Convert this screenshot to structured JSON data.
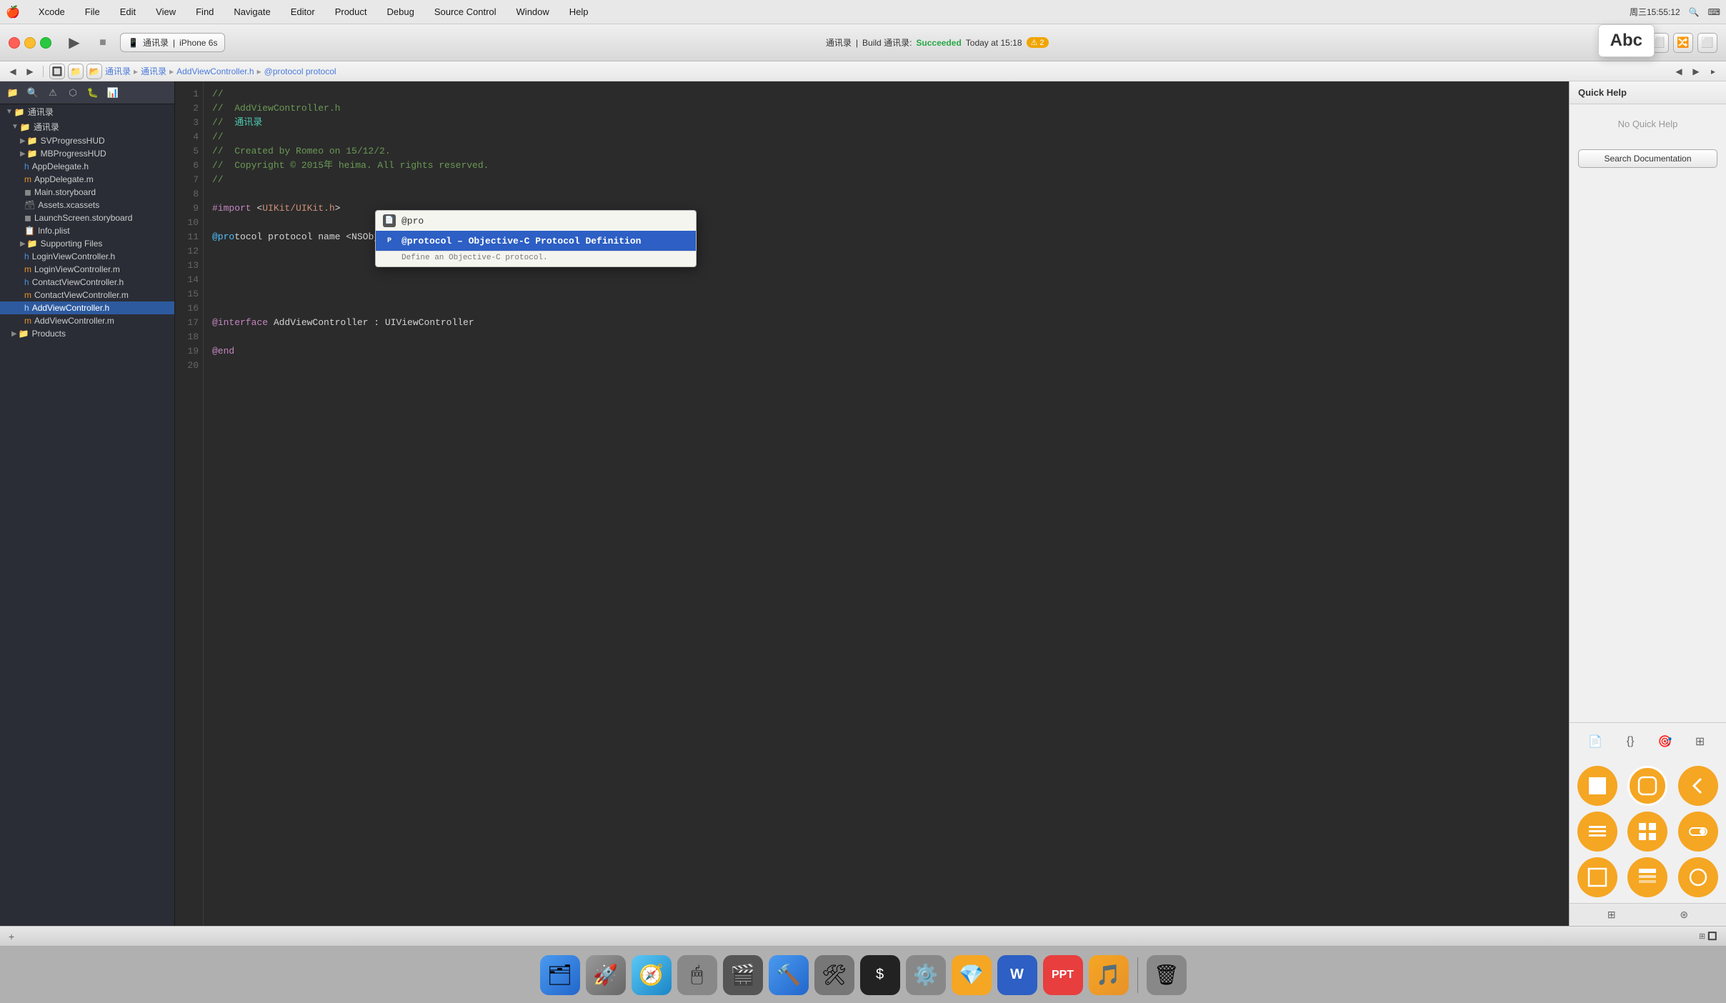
{
  "menubar": {
    "apple": "🍎",
    "items": [
      "Xcode",
      "File",
      "Edit",
      "View",
      "Find",
      "Navigate",
      "Editor",
      "Product",
      "Debug",
      "Source Control",
      "Window",
      "Help"
    ],
    "right": {
      "datetime": "周三15:55:12",
      "search_icon": "🔍",
      "input_icon": "⌨"
    }
  },
  "toolbar": {
    "traffic_lights": [
      "red",
      "yellow",
      "green"
    ],
    "run_label": "▶",
    "stop_label": "■",
    "scheme_name": "通讯录",
    "device": "iPhone 6s",
    "build_project": "通讯录",
    "build_separator": "|",
    "build_label": "Build 通讯录:",
    "build_status": "Succeeded",
    "build_time": "Today at 15:18",
    "warning_count": "⚠ 2"
  },
  "breadcrumb": {
    "items": [
      "通讯录",
      "通讯录",
      "AddViewController.h",
      "@protocol protocol"
    ]
  },
  "sidebar": {
    "title": "通讯录",
    "items": [
      {
        "id": "root-group",
        "label": "通讯录",
        "indent": 0,
        "type": "group",
        "expanded": true
      },
      {
        "id": "svprogress",
        "label": "SVProgressHUD",
        "indent": 1,
        "type": "folder",
        "expanded": false
      },
      {
        "id": "mbprogress",
        "label": "MBProgressHUD",
        "indent": 1,
        "type": "folder",
        "expanded": false
      },
      {
        "id": "appdelegate-h",
        "label": "AppDelegate.h",
        "indent": 1,
        "type": "file-h"
      },
      {
        "id": "appdelegate-m",
        "label": "AppDelegate.m",
        "indent": 1,
        "type": "file-m"
      },
      {
        "id": "main-storyboard",
        "label": "Main.storyboard",
        "indent": 1,
        "type": "file-storyboard"
      },
      {
        "id": "assets",
        "label": "Assets.xcassets",
        "indent": 1,
        "type": "file-assets"
      },
      {
        "id": "launchscreen",
        "label": "LaunchScreen.storyboard",
        "indent": 1,
        "type": "file-storyboard"
      },
      {
        "id": "info-plist",
        "label": "Info.plist",
        "indent": 1,
        "type": "file-plist"
      },
      {
        "id": "supporting",
        "label": "Supporting Files",
        "indent": 1,
        "type": "folder",
        "expanded": false
      },
      {
        "id": "loginvc-h",
        "label": "LoginViewController.h",
        "indent": 1,
        "type": "file-h"
      },
      {
        "id": "loginvc-m",
        "label": "LoginViewController.m",
        "indent": 1,
        "type": "file-m"
      },
      {
        "id": "contactvc-h",
        "label": "ContactViewController.h",
        "indent": 1,
        "type": "file-h"
      },
      {
        "id": "contactvc-m",
        "label": "ContactViewController.m",
        "indent": 1,
        "type": "file-m"
      },
      {
        "id": "addvc-h",
        "label": "AddViewController.h",
        "indent": 1,
        "type": "file-h",
        "selected": true
      },
      {
        "id": "addvc-m",
        "label": "AddViewController.m",
        "indent": 1,
        "type": "file-m"
      },
      {
        "id": "products",
        "label": "Products",
        "indent": 0,
        "type": "folder-products",
        "expanded": false
      }
    ]
  },
  "code": {
    "lines": [
      {
        "num": 1,
        "content": "//"
      },
      {
        "num": 2,
        "content": "//  AddViewController.h"
      },
      {
        "num": 3,
        "content": "//  通讯录"
      },
      {
        "num": 4,
        "content": "//"
      },
      {
        "num": 5,
        "content": "//  Created by Romeo on 15/12/2."
      },
      {
        "num": 6,
        "content": "//  Copyright © 2015年 heima. All rights reserved."
      },
      {
        "num": 7,
        "content": "//"
      },
      {
        "num": 8,
        "content": ""
      },
      {
        "num": 9,
        "content": "#import <UIKit/UIKit.h>"
      },
      {
        "num": 10,
        "content": ""
      },
      {
        "num": 11,
        "content": "@protocol protocol name <NSObject>"
      },
      {
        "num": 12,
        "content": ""
      },
      {
        "num": 13,
        "content": ""
      },
      {
        "num": 14,
        "content": ""
      },
      {
        "num": 15,
        "content": ""
      },
      {
        "num": 16,
        "content": ""
      },
      {
        "num": 17,
        "content": "@interface AddViewController : UIViewController"
      },
      {
        "num": 18,
        "content": ""
      },
      {
        "num": 19,
        "content": "@end"
      },
      {
        "num": 20,
        "content": ""
      }
    ]
  },
  "autocomplete": {
    "items": [
      {
        "id": "pro-snippet",
        "icon": "📄",
        "icon_type": "gray",
        "label": "@pro"
      },
      {
        "id": "protocol-def",
        "icon": "P",
        "icon_type": "blue",
        "label": "@protocol – Objective-C Protocol Definition",
        "selected": true
      }
    ],
    "description": "Define an Objective-C protocol."
  },
  "quick_help": {
    "title": "Quick Help",
    "empty_msg": "No Quick Help",
    "search_btn": "Search Documentation"
  },
  "right_panel_icons": {
    "icons": [
      "📄",
      "{}",
      "🎯",
      "⊞"
    ],
    "ui_elements": [
      {
        "id": "square",
        "shape": "square"
      },
      {
        "id": "rounded-rect",
        "shape": "rounded-rect"
      },
      {
        "id": "chevron-left",
        "shape": "chevron-left"
      },
      {
        "id": "list",
        "shape": "list"
      },
      {
        "id": "grid",
        "shape": "grid"
      },
      {
        "id": "toggle",
        "shape": "toggle"
      },
      {
        "id": "square2",
        "shape": "square2"
      },
      {
        "id": "table",
        "shape": "table"
      },
      {
        "id": "circle",
        "shape": "circle"
      }
    ]
  },
  "dock": {
    "items": [
      {
        "id": "finder",
        "label": "Finder",
        "color": "#4a9aef"
      },
      {
        "id": "launchpad",
        "label": "Launchpad",
        "color": "#888"
      },
      {
        "id": "safari",
        "label": "Safari",
        "color": "#4a9aef"
      },
      {
        "id": "mousepose",
        "label": "Mousepose",
        "color": "#888"
      },
      {
        "id": "footage",
        "label": "Footage",
        "color": "#888"
      },
      {
        "id": "xcode",
        "label": "Xcode",
        "color": "#4a9aef"
      },
      {
        "id": "hammer",
        "label": "Hammer",
        "color": "#888"
      },
      {
        "id": "terminal",
        "label": "Terminal",
        "color": "#333"
      },
      {
        "id": "settings",
        "label": "Settings",
        "color": "#888"
      },
      {
        "id": "sketch",
        "label": "Sketch",
        "color": "#f5a623"
      },
      {
        "id": "word",
        "label": "Word",
        "color": "#2d5fc4"
      },
      {
        "id": "ppt",
        "label": "PowerPoint",
        "color": "#e83e3e"
      },
      {
        "id": "itunes",
        "label": "iTunes",
        "color": "#f5a623"
      },
      {
        "id": "trash",
        "label": "Trash",
        "color": "#888"
      }
    ]
  },
  "abc_popup": "Abc"
}
